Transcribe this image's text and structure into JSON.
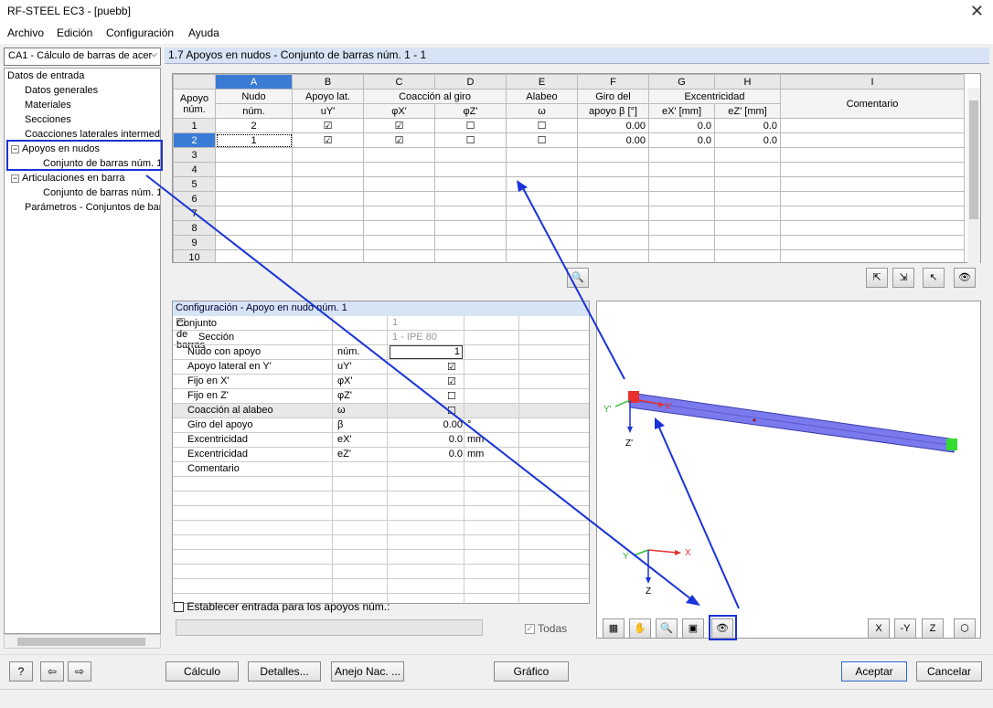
{
  "window": {
    "title": "RF-STEEL EC3 - [puebb]",
    "close_glyph": "✕"
  },
  "menu": [
    "Archivo",
    "Edición",
    "Configuración",
    "Ayuda"
  ],
  "case_combo": {
    "value": "CA1 - Cálculo de barras de acer"
  },
  "tree": {
    "root": "Datos de entrada",
    "items": [
      "Datos generales",
      "Materiales",
      "Secciones",
      "Coacciones laterales intermedia",
      "Apoyos en nudos",
      "Conjunto de barras núm. 1",
      "Articulaciones en barra",
      "Conjunto de barras núm. 1",
      "Parámetros - Conjuntos de bar"
    ]
  },
  "panel_title": "1.7 Apoyos en nudos - Conjunto de barras núm. 1 - 1",
  "grid": {
    "letters": [
      "A",
      "B",
      "C",
      "D",
      "E",
      "F",
      "G",
      "H",
      "I"
    ],
    "head1": [
      "Apoyo",
      "Nudo",
      "Apoyo lat.",
      "Coacción al giro",
      "Alabeo",
      "Giro del",
      "Excentricidad",
      "Comentario"
    ],
    "head2": [
      "núm.",
      "núm.",
      "uY'",
      "φX'",
      "φZ'",
      "ω",
      "apoyo β [°]",
      "eX' [mm]",
      "eZ' [mm]"
    ],
    "rows": [
      {
        "n": "1",
        "nudo": "2",
        "uy": "☑",
        "fx": "☑",
        "fz": "☐",
        "w": "☐",
        "beta": "0.00",
        "ex": "0.0",
        "ez": "0.0"
      },
      {
        "n": "2",
        "nudo": "1",
        "uy": "☑",
        "fx": "☑",
        "fz": "☐",
        "w": "☐",
        "beta": "0.00",
        "ex": "0.0",
        "ez": "0.0"
      },
      {
        "n": "3"
      },
      {
        "n": "4"
      },
      {
        "n": "5"
      },
      {
        "n": "6"
      },
      {
        "n": "7"
      },
      {
        "n": "8"
      },
      {
        "n": "9"
      },
      {
        "n": "10"
      }
    ]
  },
  "config": {
    "title": "Configuración - Apoyo en nudo núm. 1",
    "rows": [
      {
        "label": "Conjunto de barras",
        "sym": "",
        "val": "1",
        "unit": ""
      },
      {
        "label": "Sección",
        "sym": "",
        "val": "1 - IPE 80",
        "unit": ""
      },
      {
        "label": "Nudo con apoyo",
        "sym": "núm.",
        "val": "1",
        "unit": ""
      },
      {
        "label": "Apoyo lateral en Y'",
        "sym": "uY'",
        "val": "☑",
        "unit": ""
      },
      {
        "label": "Fijo en X'",
        "sym": "φX'",
        "val": "☑",
        "unit": ""
      },
      {
        "label": "Fijo en Z'",
        "sym": "φZ'",
        "val": "☐",
        "unit": ""
      },
      {
        "label": "Coacción al alabeo",
        "sym": "ω",
        "val": "☐",
        "unit": ""
      },
      {
        "label": "Giro del apoyo",
        "sym": "β",
        "val": "0.00",
        "unit": "°"
      },
      {
        "label": "Excentricidad",
        "sym": "eX'",
        "val": "0.0",
        "unit": "mm"
      },
      {
        "label": "Excentricidad",
        "sym": "eZ'",
        "val": "0.0",
        "unit": "mm"
      },
      {
        "label": "Comentario",
        "sym": "",
        "val": "",
        "unit": ""
      }
    ],
    "establecer": "Establecer entrada para los apoyos núm.:",
    "todas": "Todas"
  },
  "view": {
    "axis_x": "X'",
    "axis_y": "Y'",
    "axis_z": "Z'",
    "g_x": "X",
    "g_y": "Y",
    "g_z": "Z",
    "beam_color": "#7a7aee",
    "support_color": "#e83030",
    "end_color": "#33dd33"
  },
  "buttons": {
    "calculo": "Cálculo",
    "detalles": "Detalles...",
    "anejo": "Anejo Nac. ...",
    "grafico": "Gráfico",
    "aceptar": "Aceptar",
    "cancelar": "Cancelar"
  },
  "annotation_color": "#1a33d8"
}
